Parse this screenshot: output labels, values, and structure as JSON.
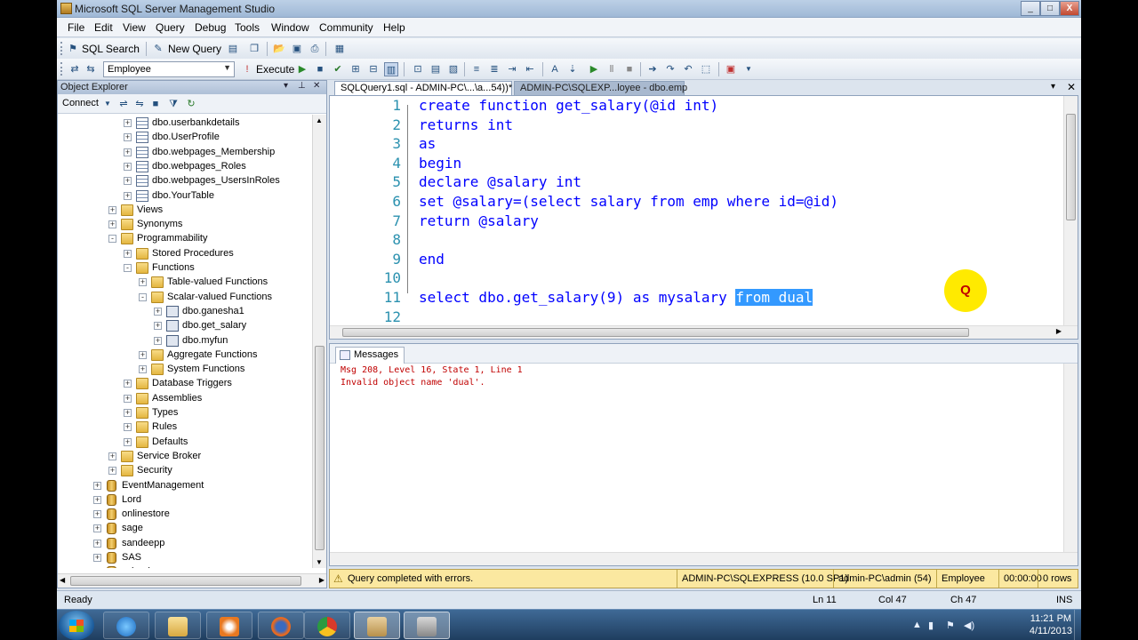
{
  "window": {
    "title": "Microsoft SQL Server Management Studio",
    "buttons": [
      "_",
      "□",
      "X"
    ]
  },
  "menu": [
    "File",
    "Edit",
    "View",
    "Query",
    "Debug",
    "Tools",
    "Window",
    "Community",
    "Help"
  ],
  "toolbar1": {
    "sql_search": "SQL Search",
    "new_query": "New Query"
  },
  "toolbar2": {
    "database": "Employee",
    "execute": "Execute"
  },
  "object_explorer": {
    "title": "Object Explorer",
    "connect": "Connect",
    "tree": [
      {
        "label": "dbo.userbankdetails",
        "level": 2,
        "icon": "table-icon",
        "exp": "+"
      },
      {
        "label": "dbo.UserProfile",
        "level": 2,
        "icon": "table-icon",
        "exp": "+"
      },
      {
        "label": "dbo.webpages_Membership",
        "level": 2,
        "icon": "table-icon",
        "exp": "+"
      },
      {
        "label": "dbo.webpages_Roles",
        "level": 2,
        "icon": "table-icon",
        "exp": "+"
      },
      {
        "label": "dbo.webpages_UsersInRoles",
        "level": 2,
        "icon": "table-icon",
        "exp": "+"
      },
      {
        "label": "dbo.YourTable",
        "level": 2,
        "icon": "table-icon",
        "exp": "+"
      },
      {
        "label": "Views",
        "level": 1,
        "icon": "folder-icon",
        "exp": "+"
      },
      {
        "label": "Synonyms",
        "level": 1,
        "icon": "folder-icon",
        "exp": "+"
      },
      {
        "label": "Programmability",
        "level": 1,
        "icon": "folder-icon",
        "exp": "-"
      },
      {
        "label": "Stored Procedures",
        "level": 2,
        "icon": "folder-icon",
        "exp": "+"
      },
      {
        "label": "Functions",
        "level": 2,
        "icon": "folder-icon",
        "exp": "-"
      },
      {
        "label": "Table-valued Functions",
        "level": 3,
        "icon": "folder-icon",
        "exp": "+"
      },
      {
        "label": "Scalar-valued Functions",
        "level": 3,
        "icon": "folder-icon",
        "exp": "-"
      },
      {
        "label": "dbo.ganesha1",
        "level": 4,
        "icon": "function-icon",
        "exp": "+"
      },
      {
        "label": "dbo.get_salary",
        "level": 4,
        "icon": "function-icon",
        "exp": "+"
      },
      {
        "label": "dbo.myfun",
        "level": 4,
        "icon": "function-icon",
        "exp": "+"
      },
      {
        "label": "Aggregate Functions",
        "level": 3,
        "icon": "folder-icon",
        "exp": "+"
      },
      {
        "label": "System Functions",
        "level": 3,
        "icon": "folder-icon",
        "exp": "+"
      },
      {
        "label": "Database Triggers",
        "level": 2,
        "icon": "folder-icon",
        "exp": "+"
      },
      {
        "label": "Assemblies",
        "level": 2,
        "icon": "folder-icon",
        "exp": "+"
      },
      {
        "label": "Types",
        "level": 2,
        "icon": "folder-icon",
        "exp": "+"
      },
      {
        "label": "Rules",
        "level": 2,
        "icon": "folder-icon",
        "exp": "+"
      },
      {
        "label": "Defaults",
        "level": 2,
        "icon": "folder-icon",
        "exp": "+"
      },
      {
        "label": "Service Broker",
        "level": 1,
        "icon": "folder-icon",
        "exp": "+"
      },
      {
        "label": "Security",
        "level": 1,
        "icon": "folder-icon",
        "exp": "+"
      },
      {
        "label": "EventManagement",
        "level": 0,
        "icon": "database-icon",
        "exp": "+"
      },
      {
        "label": "Lord",
        "level": 0,
        "icon": "database-icon",
        "exp": "+"
      },
      {
        "label": "onlinestore",
        "level": 0,
        "icon": "database-icon",
        "exp": "+"
      },
      {
        "label": "sage",
        "level": 0,
        "icon": "database-icon",
        "exp": "+"
      },
      {
        "label": "sandeepp",
        "level": 0,
        "icon": "database-icon",
        "exp": "+"
      },
      {
        "label": "SAS",
        "level": 0,
        "icon": "database-icon",
        "exp": "+"
      },
      {
        "label": "school",
        "level": 0,
        "icon": "database-icon",
        "exp": "+"
      }
    ]
  },
  "tabs": [
    {
      "label": "SQLQuery1.sql - ADMIN-PC\\...\\a...54))*",
      "active": true
    },
    {
      "label": "ADMIN-PC\\SQLEXP...loyee - dbo.emp",
      "active": false
    }
  ],
  "editor": {
    "line_numbers": [
      "1",
      "2",
      "3",
      "4",
      "5",
      "6",
      "7",
      "8",
      "9",
      "10",
      "11",
      "12"
    ],
    "lines": [
      [
        {
          "t": "create function get_salary(@id int)",
          "k": "kw"
        }
      ],
      [
        {
          "t": "returns int",
          "k": "kw"
        }
      ],
      [
        {
          "t": "as",
          "k": "kw"
        }
      ],
      [
        {
          "t": "begin",
          "k": "kw"
        }
      ],
      [
        {
          "t": "declare @salary int",
          "k": "kw"
        }
      ],
      [
        {
          "t": "set @salary=(select salary from emp where id=@id)",
          "k": "kw"
        }
      ],
      [
        {
          "t": "return @salary",
          "k": "kw"
        }
      ],
      [
        {
          "t": "",
          "k": ""
        }
      ],
      [
        {
          "t": "end",
          "k": "kw"
        }
      ],
      [
        {
          "t": "",
          "k": ""
        }
      ],
      [
        {
          "t": "select dbo.get_salary(9) as mysalary ",
          "k": "kw"
        },
        {
          "t": "from dual",
          "k": "sel"
        }
      ],
      [
        {
          "t": "",
          "k": ""
        }
      ]
    ],
    "cursor_marker": "Q"
  },
  "results": {
    "tab": "Messages",
    "messages": [
      "Msg 208, Level 16, State 1, Line 1",
      "Invalid object name 'dual'."
    ]
  },
  "query_status": {
    "message": "Query completed with errors.",
    "server": "ADMIN-PC\\SQLEXPRESS (10.0 SP1)",
    "user": "admin-PC\\admin (54)",
    "database": "Employee",
    "time": "00:00:00",
    "rows": "0 rows"
  },
  "status": {
    "ready": "Ready",
    "ln": "Ln 11",
    "col": "Col 47",
    "ch": "Ch 47",
    "ins": "INS"
  },
  "taskbar": {
    "time": "11:21 PM",
    "date": "4/11/2013"
  }
}
